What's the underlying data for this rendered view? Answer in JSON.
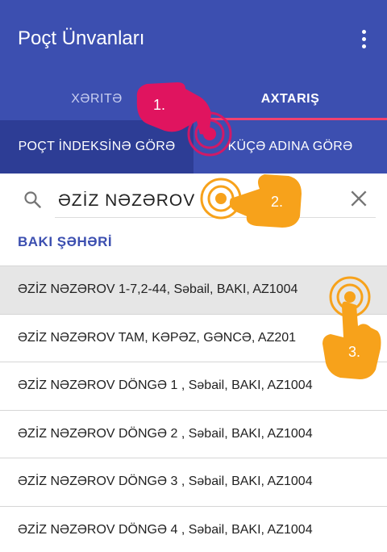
{
  "app": {
    "title": "Poçt Ünvanları",
    "menu_icon": "more-vert-icon"
  },
  "tabs": [
    {
      "label": "XƏRITƏ",
      "selected": false
    },
    {
      "label": "AXTARIŞ",
      "selected": true
    }
  ],
  "subtabs": [
    {
      "label": "POÇT İNDEKSİNƏ GÖRƏ",
      "selected": false
    },
    {
      "label": "KÜÇƏ ADINA GÖRƏ",
      "selected": true
    }
  ],
  "search": {
    "value": "ƏZİZ NƏZƏROV",
    "icon": "search-icon",
    "clear_icon": "close-icon"
  },
  "section": {
    "title": "BAKI ŞƏHƏRİ"
  },
  "results": [
    "ƏZİZ NƏZƏROV 1-7,2-44, Səbail, BAKI, AZ1004",
    "ƏZİZ NƏZƏROV TAM, KƏPƏZ, GƏNCƏ, AZ201",
    "ƏZİZ NƏZƏROV DÖNGƏ 1 , Səbail, BAKI, AZ1004",
    "ƏZİZ NƏZƏROV DÖNGƏ 2 , Səbail, BAKI, AZ1004",
    "ƏZİZ NƏZƏROV DÖNGƏ 3 , Səbail, BAKI, AZ1004",
    "ƏZİZ NƏZƏROV DÖNGƏ 4 , Səbail, BAKI, AZ1004"
  ],
  "annotations": [
    {
      "label": "1.",
      "color": "#e0145f"
    },
    {
      "label": "2.",
      "color": "#f7a21b"
    },
    {
      "label": "3.",
      "color": "#f7a21b"
    }
  ]
}
